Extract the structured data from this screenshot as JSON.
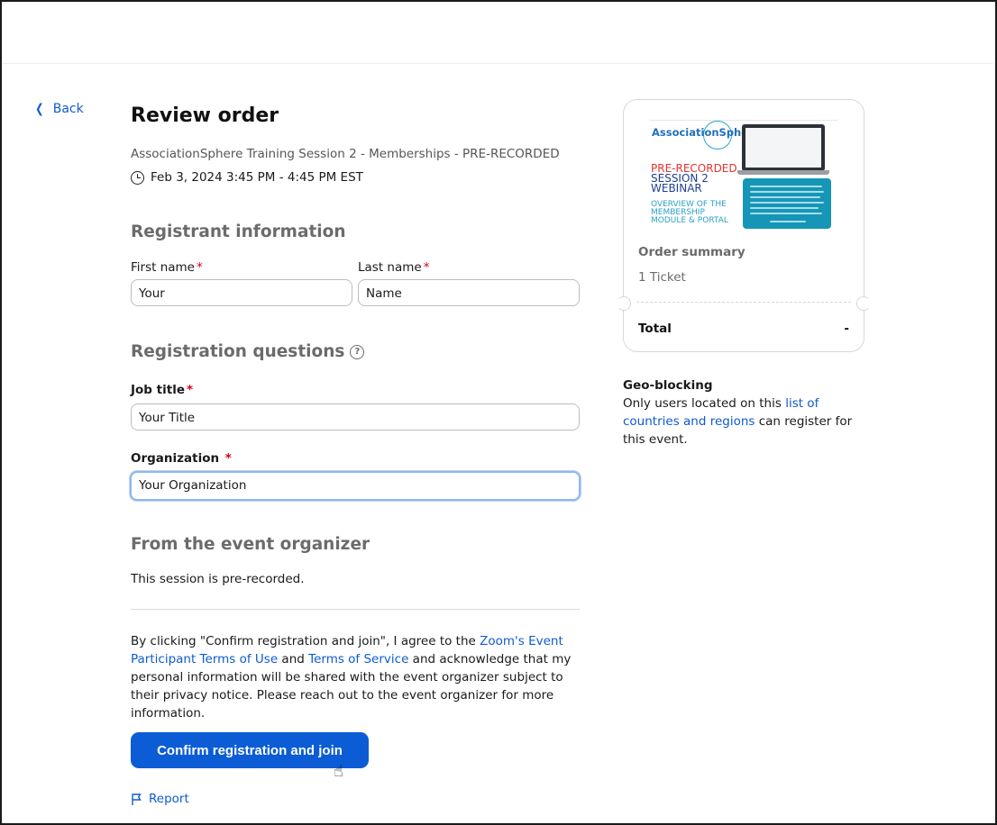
{
  "nav": {
    "back_label": "Back"
  },
  "order": {
    "heading": "Review order",
    "event_title": "AssociationSphere Training Session 2 - Memberships - PRE-RECORDED",
    "event_time": "Feb 3, 2024 3:45 PM - 4:45 PM EST"
  },
  "registrant": {
    "heading": "Registrant information",
    "first_name_label": "First name",
    "first_name_value": "Your",
    "last_name_label": "Last name",
    "last_name_value": "Name"
  },
  "questions": {
    "heading": "Registration questions",
    "job_title_label": "Job title",
    "job_title_value": "Your Title",
    "organization_label": "Organization",
    "organization_value": "Your Organization"
  },
  "organizer": {
    "heading": "From the event organizer",
    "message": "This session is pre-recorded."
  },
  "legal": {
    "part1": "By clicking \"Confirm registration and join\", I agree to the ",
    "link1": "Zoom's Event Participant Terms of Use",
    "part2": " and ",
    "link2": "Terms of Service",
    "part3": " and acknowledge that my personal information will be shared with the event organizer subject to their privacy notice. Please reach out to the event organizer for more information."
  },
  "actions": {
    "confirm_label": "Confirm registration and join",
    "report_label": "Report"
  },
  "summary": {
    "promo": {
      "brand": "AssociationSphere",
      "line1": "PRE-RECORDED",
      "line2": "SESSION 2",
      "line3": "WEBINAR",
      "line4": "OVERVIEW OF THE",
      "line5": "MEMBERSHIP",
      "line6": "MODULE & PORTAL"
    },
    "title": "Order summary",
    "ticket": "1 Ticket",
    "total_label": "Total",
    "total_value": "-"
  },
  "geo": {
    "title": "Geo-blocking",
    "part1": "Only users located on this ",
    "link": "list of countries and regions",
    "part2": " can register for this event."
  },
  "colors": {
    "accent": "#0b5cd5",
    "required": "#d0021b",
    "muted_heading": "#6b6b6b"
  }
}
